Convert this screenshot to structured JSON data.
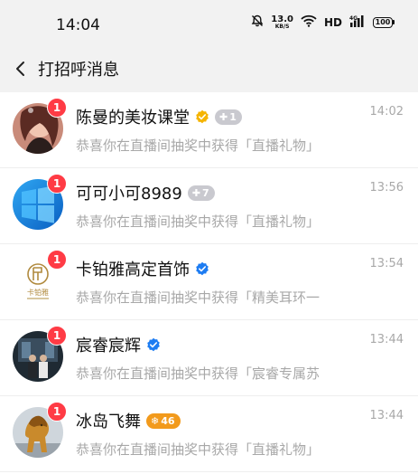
{
  "status": {
    "time": "14:04",
    "net_speed": "13.0",
    "net_unit": "KB/S",
    "hd": "HD",
    "battery": "100"
  },
  "nav": {
    "title": "打招呼消息"
  },
  "messages": [
    {
      "name": "陈曼的美妆课堂",
      "verified": true,
      "verified_color": "#f5b400",
      "badge": "1",
      "badge_style": "gray",
      "time": "14:02",
      "preview": "恭喜你在直播间抽奖中获得「直播礼物」",
      "unread": "1"
    },
    {
      "name": "可可小可8989",
      "verified": false,
      "badge": "7",
      "badge_style": "gray",
      "time": "13:56",
      "preview": "恭喜你在直播间抽奖中获得「直播礼物」",
      "unread": "1"
    },
    {
      "name": "卡铂雅高定首饰",
      "verified": true,
      "verified_color": "#1d7cf2",
      "badge": "",
      "time": "13:54",
      "preview": "恭喜你在直播间抽奖中获得「精美耳环一",
      "unread": "1",
      "avatar_text": "卡铂雅"
    },
    {
      "name": "宸睿宸辉",
      "verified": true,
      "verified_color": "#1d7cf2",
      "badge": "",
      "time": "13:44",
      "preview": "恭喜你在直播间抽奖中获得「宸睿专属苏",
      "unread": "1"
    },
    {
      "name": "冰岛飞舞",
      "verified": false,
      "badge": "46",
      "badge_style": "orange",
      "time": "13:44",
      "preview": "恭喜你在直播间抽奖中获得「直播礼物」",
      "unread": "1"
    }
  ]
}
